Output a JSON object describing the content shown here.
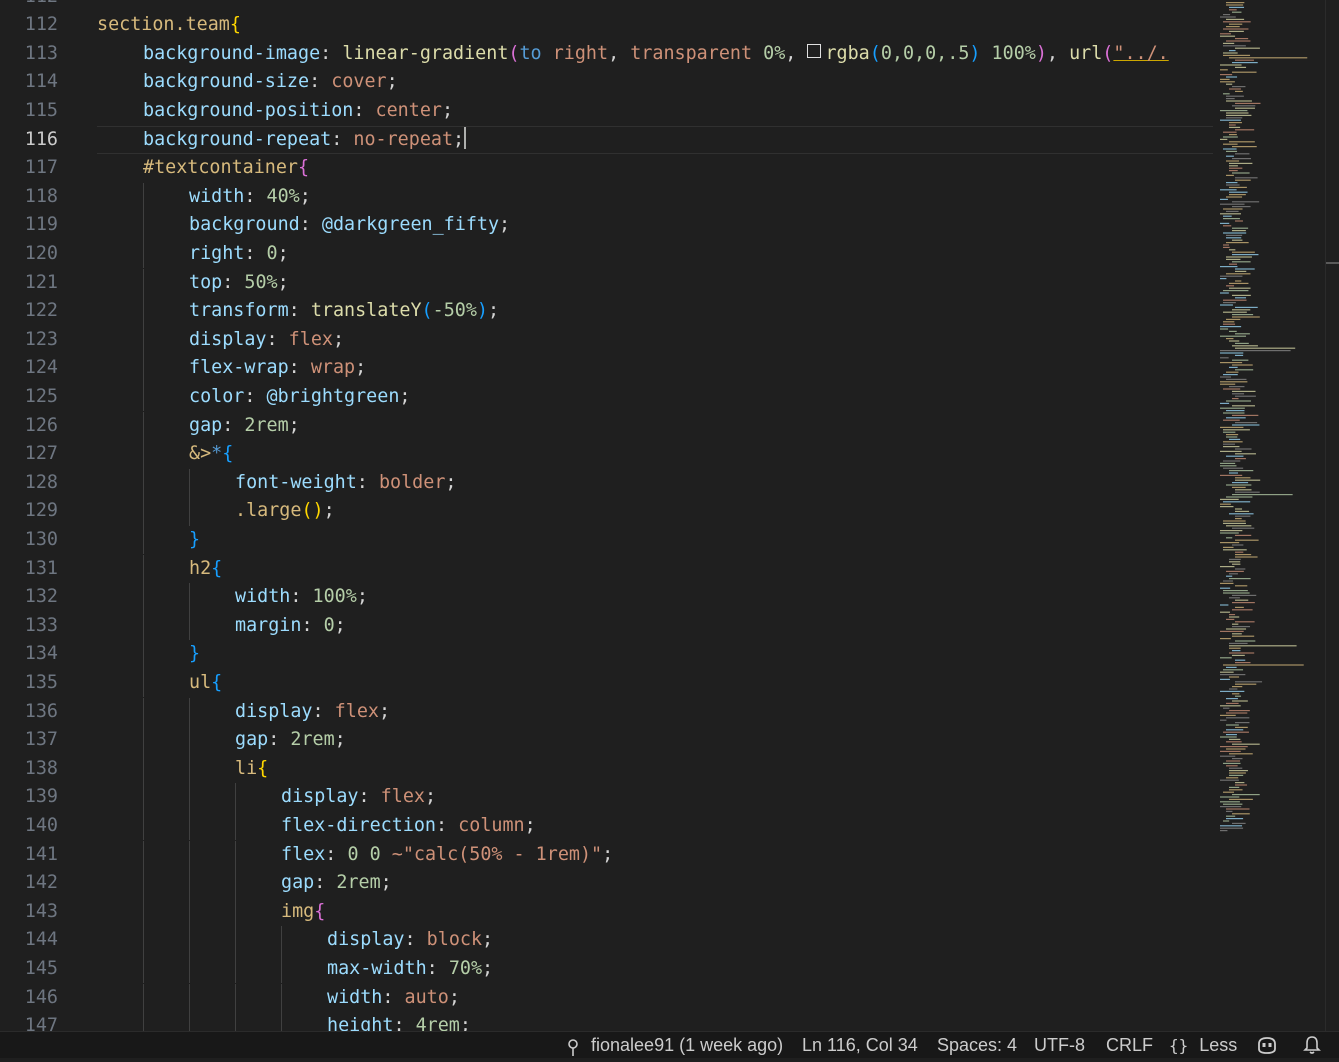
{
  "editor": {
    "current_line": 116,
    "lines": [
      {
        "n": 112,
        "indent": 0,
        "tokens": []
      },
      {
        "n": 112,
        "indent": 0,
        "tokens": [
          [
            "section.team",
            "t-sel"
          ],
          [
            "{",
            "t-b1"
          ]
        ]
      },
      {
        "n": 113,
        "indent": 1,
        "tokens": [
          [
            "background-image",
            "t-prop"
          ],
          [
            ": ",
            "t-punc"
          ],
          [
            "linear-gradient",
            "t-fn"
          ],
          [
            "(",
            "t-b2"
          ],
          [
            "to",
            "t-kw"
          ],
          [
            " ",
            "t-punc"
          ],
          [
            "right",
            "t-val"
          ],
          [
            ", ",
            "t-punc"
          ],
          [
            "transparent",
            "t-val"
          ],
          [
            " ",
            "t-punc"
          ],
          [
            "0%",
            "t-num"
          ],
          [
            ", ",
            "t-punc"
          ],
          [
            "SWATCH",
            "swatch"
          ],
          [
            "rgba",
            "t-fn"
          ],
          [
            "(",
            "t-b3"
          ],
          [
            "0,0,0,.5",
            "t-num"
          ],
          [
            ")",
            "t-b3"
          ],
          [
            " ",
            "t-punc"
          ],
          [
            "100%",
            "t-num"
          ],
          [
            ")",
            "t-b2"
          ],
          [
            ", ",
            "t-punc"
          ],
          [
            "url",
            "t-fn"
          ],
          [
            "(",
            "t-b2"
          ],
          [
            "\"../.",
            "t-str t-u"
          ]
        ]
      },
      {
        "n": 114,
        "indent": 1,
        "tokens": [
          [
            "background-size",
            "t-prop"
          ],
          [
            ": ",
            "t-punc"
          ],
          [
            "cover",
            "t-val"
          ],
          [
            ";",
            "t-punc"
          ]
        ]
      },
      {
        "n": 115,
        "indent": 1,
        "tokens": [
          [
            "background-position",
            "t-prop"
          ],
          [
            ": ",
            "t-punc"
          ],
          [
            "center",
            "t-val"
          ],
          [
            ";",
            "t-punc"
          ]
        ]
      },
      {
        "n": 116,
        "indent": 1,
        "tokens": [
          [
            "background-repeat",
            "t-prop"
          ],
          [
            ": ",
            "t-punc"
          ],
          [
            "no-repeat",
            "t-val"
          ],
          [
            ";",
            "t-punc"
          ],
          [
            "CURSOR",
            "cursor"
          ]
        ]
      },
      {
        "n": 117,
        "indent": 1,
        "tokens": [
          [
            "#textcontainer",
            "t-sel"
          ],
          [
            "{",
            "t-b2"
          ]
        ]
      },
      {
        "n": 118,
        "indent": 2,
        "tokens": [
          [
            "width",
            "t-prop"
          ],
          [
            ": ",
            "t-punc"
          ],
          [
            "40%",
            "t-num"
          ],
          [
            ";",
            "t-punc"
          ]
        ]
      },
      {
        "n": 119,
        "indent": 2,
        "tokens": [
          [
            "background",
            "t-prop"
          ],
          [
            ": ",
            "t-punc"
          ],
          [
            "@darkgreen_fifty",
            "t-var"
          ],
          [
            ";",
            "t-punc"
          ]
        ]
      },
      {
        "n": 120,
        "indent": 2,
        "tokens": [
          [
            "right",
            "t-prop"
          ],
          [
            ": ",
            "t-punc"
          ],
          [
            "0",
            "t-num"
          ],
          [
            ";",
            "t-punc"
          ]
        ]
      },
      {
        "n": 121,
        "indent": 2,
        "tokens": [
          [
            "top",
            "t-prop"
          ],
          [
            ": ",
            "t-punc"
          ],
          [
            "50%",
            "t-num"
          ],
          [
            ";",
            "t-punc"
          ]
        ]
      },
      {
        "n": 122,
        "indent": 2,
        "tokens": [
          [
            "transform",
            "t-prop"
          ],
          [
            ": ",
            "t-punc"
          ],
          [
            "translateY",
            "t-fn"
          ],
          [
            "(",
            "t-b3"
          ],
          [
            "-50%",
            "t-num"
          ],
          [
            ")",
            "t-b3"
          ],
          [
            ";",
            "t-punc"
          ]
        ]
      },
      {
        "n": 123,
        "indent": 2,
        "tokens": [
          [
            "display",
            "t-prop"
          ],
          [
            ": ",
            "t-punc"
          ],
          [
            "flex",
            "t-val"
          ],
          [
            ";",
            "t-punc"
          ]
        ]
      },
      {
        "n": 124,
        "indent": 2,
        "tokens": [
          [
            "flex-wrap",
            "t-prop"
          ],
          [
            ": ",
            "t-punc"
          ],
          [
            "wrap",
            "t-val"
          ],
          [
            ";",
            "t-punc"
          ]
        ]
      },
      {
        "n": 125,
        "indent": 2,
        "tokens": [
          [
            "color",
            "t-prop"
          ],
          [
            ": ",
            "t-punc"
          ],
          [
            "@brightgreen",
            "t-var"
          ],
          [
            ";",
            "t-punc"
          ]
        ]
      },
      {
        "n": 126,
        "indent": 2,
        "tokens": [
          [
            "gap",
            "t-prop"
          ],
          [
            ": ",
            "t-punc"
          ],
          [
            "2rem",
            "t-num"
          ],
          [
            ";",
            "t-punc"
          ]
        ]
      },
      {
        "n": 127,
        "indent": 2,
        "tokens": [
          [
            "&>",
            "t-sel"
          ],
          [
            "*",
            "t-kw"
          ],
          [
            "{",
            "t-b3"
          ]
        ]
      },
      {
        "n": 128,
        "indent": 3,
        "tokens": [
          [
            "font-weight",
            "t-prop"
          ],
          [
            ": ",
            "t-punc"
          ],
          [
            "bolder",
            "t-val"
          ],
          [
            ";",
            "t-punc"
          ]
        ]
      },
      {
        "n": 129,
        "indent": 3,
        "tokens": [
          [
            ".large",
            "t-sel"
          ],
          [
            "()",
            "t-b1"
          ],
          [
            ";",
            "t-punc"
          ]
        ]
      },
      {
        "n": 130,
        "indent": 2,
        "tokens": [
          [
            "}",
            "t-b3"
          ]
        ]
      },
      {
        "n": 131,
        "indent": 2,
        "tokens": [
          [
            "h2",
            "t-sel"
          ],
          [
            "{",
            "t-b3"
          ]
        ]
      },
      {
        "n": 132,
        "indent": 3,
        "tokens": [
          [
            "width",
            "t-prop"
          ],
          [
            ": ",
            "t-punc"
          ],
          [
            "100%",
            "t-num"
          ],
          [
            ";",
            "t-punc"
          ]
        ]
      },
      {
        "n": 133,
        "indent": 3,
        "tokens": [
          [
            "margin",
            "t-prop"
          ],
          [
            ": ",
            "t-punc"
          ],
          [
            "0",
            "t-num"
          ],
          [
            ";",
            "t-punc"
          ]
        ]
      },
      {
        "n": 134,
        "indent": 2,
        "tokens": [
          [
            "}",
            "t-b3"
          ]
        ]
      },
      {
        "n": 135,
        "indent": 2,
        "tokens": [
          [
            "ul",
            "t-sel"
          ],
          [
            "{",
            "t-b3"
          ]
        ]
      },
      {
        "n": 136,
        "indent": 3,
        "tokens": [
          [
            "display",
            "t-prop"
          ],
          [
            ": ",
            "t-punc"
          ],
          [
            "flex",
            "t-val"
          ],
          [
            ";",
            "t-punc"
          ]
        ]
      },
      {
        "n": 137,
        "indent": 3,
        "tokens": [
          [
            "gap",
            "t-prop"
          ],
          [
            ": ",
            "t-punc"
          ],
          [
            "2rem",
            "t-num"
          ],
          [
            ";",
            "t-punc"
          ]
        ]
      },
      {
        "n": 138,
        "indent": 3,
        "tokens": [
          [
            "li",
            "t-sel"
          ],
          [
            "{",
            "t-b1"
          ]
        ]
      },
      {
        "n": 139,
        "indent": 4,
        "tokens": [
          [
            "display",
            "t-prop"
          ],
          [
            ": ",
            "t-punc"
          ],
          [
            "flex",
            "t-val"
          ],
          [
            ";",
            "t-punc"
          ]
        ]
      },
      {
        "n": 140,
        "indent": 4,
        "tokens": [
          [
            "flex-direction",
            "t-prop"
          ],
          [
            ": ",
            "t-punc"
          ],
          [
            "column",
            "t-val"
          ],
          [
            ";",
            "t-punc"
          ]
        ]
      },
      {
        "n": 141,
        "indent": 4,
        "tokens": [
          [
            "flex",
            "t-prop"
          ],
          [
            ": ",
            "t-punc"
          ],
          [
            "0 0 ",
            "t-num"
          ],
          [
            "~\"calc(50% - 1rem)\"",
            "t-str"
          ],
          [
            ";",
            "t-punc"
          ]
        ]
      },
      {
        "n": 142,
        "indent": 4,
        "tokens": [
          [
            "gap",
            "t-prop"
          ],
          [
            ": ",
            "t-punc"
          ],
          [
            "2rem",
            "t-num"
          ],
          [
            ";",
            "t-punc"
          ]
        ]
      },
      {
        "n": 143,
        "indent": 4,
        "tokens": [
          [
            "img",
            "t-sel"
          ],
          [
            "{",
            "t-b2"
          ]
        ]
      },
      {
        "n": 144,
        "indent": 5,
        "tokens": [
          [
            "display",
            "t-prop"
          ],
          [
            ": ",
            "t-punc"
          ],
          [
            "block",
            "t-val"
          ],
          [
            ";",
            "t-punc"
          ]
        ]
      },
      {
        "n": 145,
        "indent": 5,
        "tokens": [
          [
            "max-width",
            "t-prop"
          ],
          [
            ": ",
            "t-punc"
          ],
          [
            "70%",
            "t-num"
          ],
          [
            ";",
            "t-punc"
          ]
        ]
      },
      {
        "n": 146,
        "indent": 5,
        "tokens": [
          [
            "width",
            "t-prop"
          ],
          [
            ": ",
            "t-punc"
          ],
          [
            "auto",
            "t-val"
          ],
          [
            ";",
            "t-punc"
          ]
        ]
      },
      {
        "n": 147,
        "indent": 5,
        "tokens": [
          [
            "height",
            "t-prop"
          ],
          [
            ": ",
            "t-punc"
          ],
          [
            "4rem",
            "t-num"
          ],
          [
            ";",
            "t-punc"
          ]
        ]
      }
    ]
  },
  "statusbar": {
    "git_blame": "fionalee91 (1 week ago)",
    "position": "Ln 116, Col 34",
    "spaces": "Spaces: 4",
    "encoding": "UTF-8",
    "eol": "CRLF",
    "language": "Less",
    "language_icon": "braces-icon",
    "blame_icon": "git-commit-icon",
    "copilot_icon": "copilot-icon",
    "bell_icon": "bell-icon"
  }
}
